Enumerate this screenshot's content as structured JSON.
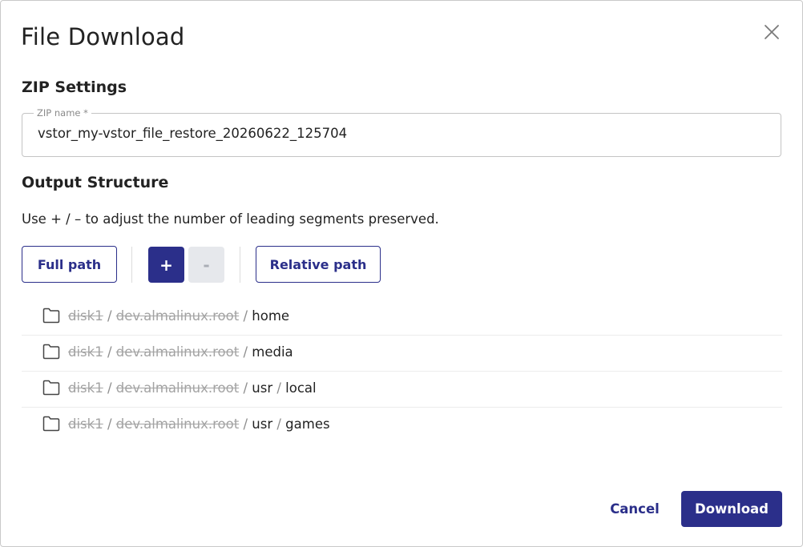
{
  "dialog": {
    "title": "File Download",
    "close_icon": "close-icon"
  },
  "zip_settings": {
    "heading": "ZIP Settings",
    "label": "ZIP name *",
    "value": "vstor_my-vstor_file_restore_20260622_125704"
  },
  "output_structure": {
    "heading": "Output Structure",
    "hint": "Use + / – to adjust the number of leading segments preserved.",
    "full_path_label": "Full path",
    "plus_label": "+",
    "minus_label": "-",
    "relative_path_label": "Relative path"
  },
  "paths": [
    {
      "struck": [
        "disk1",
        "dev.almalinux.root"
      ],
      "kept": [
        "home"
      ]
    },
    {
      "struck": [
        "disk1",
        "dev.almalinux.root"
      ],
      "kept": [
        "media"
      ]
    },
    {
      "struck": [
        "disk1",
        "dev.almalinux.root"
      ],
      "kept": [
        "usr",
        "local"
      ]
    },
    {
      "struck": [
        "disk1",
        "dev.almalinux.root"
      ],
      "kept": [
        "usr",
        "games"
      ]
    }
  ],
  "path_separator": "/",
  "footer": {
    "cancel_label": "Cancel",
    "download_label": "Download"
  },
  "colors": {
    "primary": "#2b2f8a",
    "disabled_bg": "#e6e8ec",
    "struck_text": "#a3a3a3"
  },
  "icons": {
    "folder": "folder-icon"
  }
}
